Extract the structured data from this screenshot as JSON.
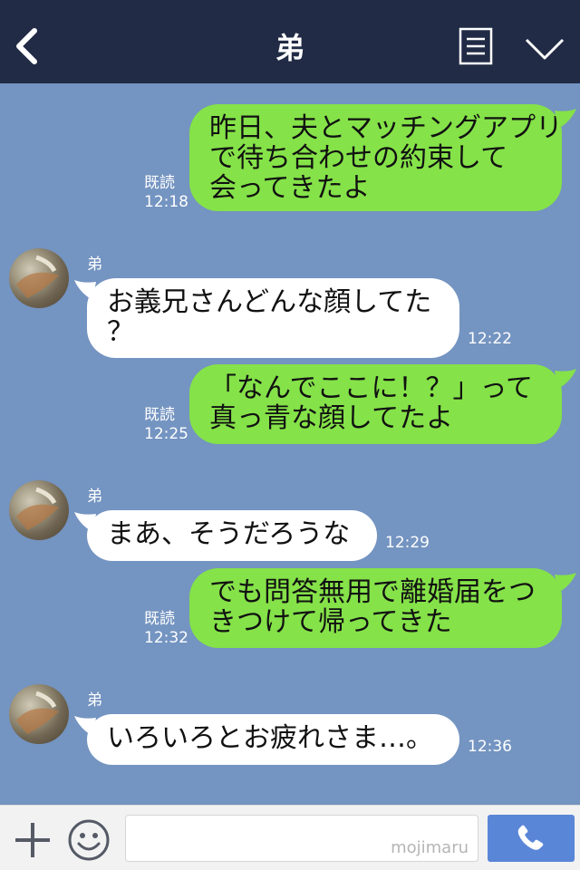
{
  "header": {
    "title": "弟"
  },
  "messages": [
    {
      "direction": "out",
      "text": "昨日、夫とマッチングアプリ\nで待ち合わせの約束して\n会ってきたよ",
      "read": "既読",
      "time": "12:18"
    },
    {
      "direction": "in",
      "sender": "弟",
      "text": "お義兄さんどんな顔してた\n？",
      "time": "12:22"
    },
    {
      "direction": "out",
      "text": "「なんでここに！？」って\n真っ青な顔してたよ",
      "read": "既読",
      "time": "12:25"
    },
    {
      "direction": "in",
      "sender": "弟",
      "text": "まあ、そうだろうな",
      "time": "12:29"
    },
    {
      "direction": "out",
      "text": "でも問答無用で離婚届をつ\nきつけて帰ってきた",
      "read": "既読",
      "time": "12:32"
    },
    {
      "direction": "in",
      "sender": "弟",
      "text": "いろいろとお疲れさま…。",
      "time": "12:36"
    }
  ],
  "input": {
    "watermark": "mojimaru"
  },
  "icons": [
    "back-icon",
    "menu-icon",
    "chevron-down-icon",
    "plus-icon",
    "smile-icon",
    "phone-icon"
  ],
  "colors": {
    "header": "#212b45",
    "background": "#7494c1",
    "outgoing_bubble": "#85e249",
    "incoming_bubble": "#ffffff",
    "call_button": "#5a86d8"
  }
}
